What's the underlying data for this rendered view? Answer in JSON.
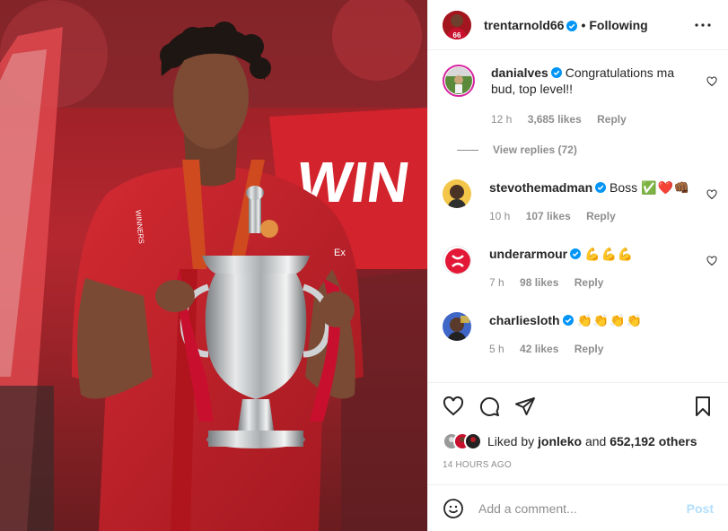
{
  "header": {
    "username": "trentarnold66",
    "separator": "•",
    "follow_label": "Following",
    "avatar_badge": "66"
  },
  "photo": {
    "banner_text": "WIN",
    "sash_text": "WINNERS",
    "shirt_badge": "Ex"
  },
  "comments": [
    {
      "username": "danialves",
      "text": "Congratulations ma bud, top level!!",
      "age": "12 h",
      "likes": "3,685 likes",
      "reply_label": "Reply",
      "view_replies": "View replies (72)"
    },
    {
      "username": "stevothemadman",
      "text": "Boss",
      "emoji": "✅❤️👊🏾",
      "age": "10 h",
      "likes": "107 likes",
      "reply_label": "Reply"
    },
    {
      "username": "underarmour",
      "text": "",
      "emoji": "💪💪💪",
      "age": "7 h",
      "likes": "98 likes",
      "reply_label": "Reply"
    },
    {
      "username": "charliesloth",
      "text": "",
      "emoji": "👏👏👏👏",
      "age": "5 h",
      "likes": "42 likes",
      "reply_label": "Reply"
    }
  ],
  "actions": {
    "icons": [
      "heart-icon",
      "comment-icon",
      "share-icon",
      "bookmark-icon"
    ]
  },
  "liked_by": {
    "prefix": "Liked by",
    "user": "jonleko",
    "conjunction": "and",
    "others": "652,192 others"
  },
  "timestamp": "14 HOURS AGO",
  "add_comment": {
    "placeholder": "Add a comment...",
    "post_label": "Post"
  },
  "colors": {
    "verified": "#0095f6",
    "post_disabled": "#b2dffc",
    "liverpool_red": "#c8102e",
    "secondary_text": "#8e8e8e"
  }
}
